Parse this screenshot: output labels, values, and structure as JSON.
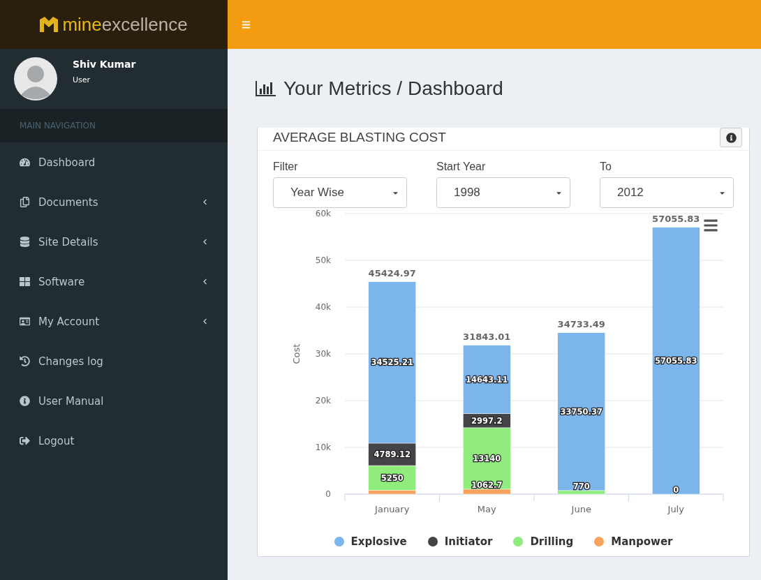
{
  "brand": {
    "part_1": "mine",
    "part_2": "excellence"
  },
  "user": {
    "name": "Shiv Kumar",
    "role": "User"
  },
  "nav_header": "MAIN NAVIGATION",
  "nav": [
    {
      "label": "Dashboard",
      "has_submenu": false
    },
    {
      "label": "Documents",
      "has_submenu": true
    },
    {
      "label": "Site Details",
      "has_submenu": true
    },
    {
      "label": "Software",
      "has_submenu": true
    },
    {
      "label": "My Account",
      "has_submenu": true
    },
    {
      "label": "Changes log",
      "has_submenu": false
    },
    {
      "label": "User Manual",
      "has_submenu": false
    },
    {
      "label": "Logout",
      "has_submenu": false
    }
  ],
  "page_title": "Your Metrics / Dashboard",
  "card": {
    "title": "AVERAGE BLASTING COST",
    "filters": [
      {
        "label": "Filter",
        "value": "Year Wise"
      },
      {
        "label": "Start Year",
        "value": "1998"
      },
      {
        "label": "To",
        "value": "2012"
      }
    ],
    "totals": [
      "45424.97",
      "31843.01",
      "34733.49",
      "57055.83"
    ],
    "chart_data": {
      "type": "bar",
      "stacked": true,
      "grid": true,
      "ylabel": "Cost",
      "categories": [
        "January",
        "May",
        "June",
        "July"
      ],
      "ylim": [
        0,
        60000
      ],
      "yticks": [
        {
          "value": 0,
          "label": "0"
        },
        {
          "value": 10000,
          "label": "10k"
        },
        {
          "value": 20000,
          "label": "20k"
        },
        {
          "value": 30000,
          "label": "30k"
        },
        {
          "value": 40000,
          "label": "40k"
        },
        {
          "value": 50000,
          "label": "50k"
        },
        {
          "value": 60000,
          "label": "60k"
        }
      ],
      "series": [
        {
          "name": "Manpower",
          "color": "#f7a35c",
          "values": [
            860,
            1062.7,
            null,
            null
          ]
        },
        {
          "name": "Drilling",
          "color": "#90ed7d",
          "values": [
            5250,
            13140,
            770,
            0
          ]
        },
        {
          "name": "Initiator",
          "color": "#434348",
          "values": [
            4789.12,
            2997.2,
            null,
            null
          ]
        },
        {
          "name": "Explosive",
          "color": "#7cb5ec",
          "values": [
            34525.21,
            14643.11,
            33750.37,
            57055.83
          ]
        }
      ],
      "value_labels": [
        [
          null,
          "1062.7",
          null,
          null
        ],
        [
          "5250",
          "13140",
          "770",
          "0"
        ],
        [
          "4789.12",
          "2997.2",
          null,
          null
        ],
        [
          "34525.21",
          "14643.11",
          "33750.37",
          "57055.83"
        ]
      ]
    }
  }
}
